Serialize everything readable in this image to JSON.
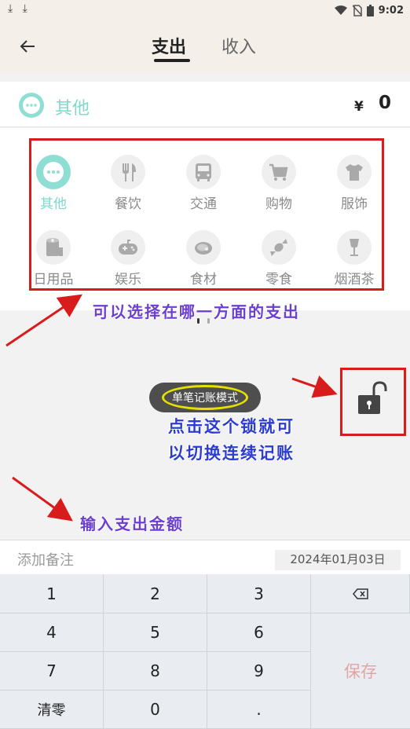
{
  "status": {
    "time": "9:02",
    "left_icons": "⤓ ⤓"
  },
  "header": {
    "tab_expense": "支出",
    "tab_income": "收入"
  },
  "selected": {
    "category": "其他",
    "currency": "¥",
    "amount": "0"
  },
  "categories": [
    {
      "label": "其他",
      "icon": "more-dots-icon"
    },
    {
      "label": "餐饮",
      "icon": "utensils-icon"
    },
    {
      "label": "交通",
      "icon": "bus-icon"
    },
    {
      "label": "购物",
      "icon": "cart-icon"
    },
    {
      "label": "服饰",
      "icon": "shirt-icon"
    },
    {
      "label": "日用品",
      "icon": "tissue-roll-icon"
    },
    {
      "label": "娱乐",
      "icon": "gamepad-icon"
    },
    {
      "label": "食材",
      "icon": "meat-icon"
    },
    {
      "label": "零食",
      "icon": "candy-icon"
    },
    {
      "label": "烟酒茶",
      "icon": "wine-glass-icon"
    }
  ],
  "mode": {
    "label": "单笔记账模式"
  },
  "annotations": {
    "category_hint": "可以选择在哪一方面的支出",
    "lock_hint_line1": "点击这个锁就可",
    "lock_hint_line2": "以切换连续记账",
    "amount_hint": "输入支出金额"
  },
  "note": {
    "placeholder": "添加备注",
    "date": "2024年01月03日"
  },
  "keypad": {
    "k1": "1",
    "k2": "2",
    "k3": "3",
    "k4": "4",
    "k5": "5",
    "k6": "6",
    "k7": "7",
    "k8": "8",
    "k9": "9",
    "clear": "清零",
    "k0": "0",
    "dot": ".",
    "save": "保存"
  },
  "colors": {
    "accent": "#8fded3",
    "annotation_red": "#d81c1c",
    "annotation_purple": "#6b3fd0",
    "annotation_blue": "#2c3cd0"
  }
}
